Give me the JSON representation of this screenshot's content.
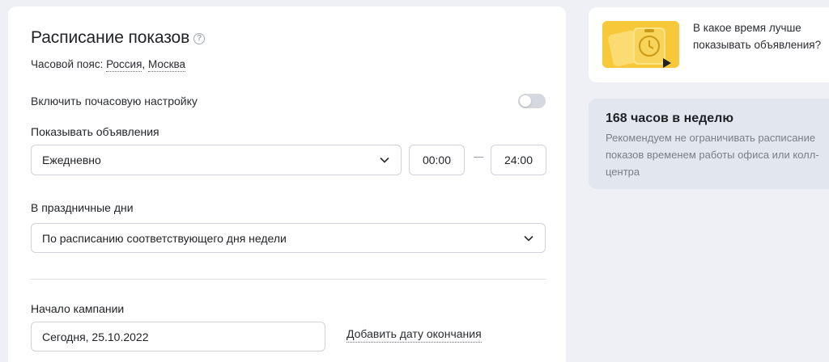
{
  "schedule": {
    "title": "Расписание показов",
    "help_icon": "?",
    "timezone_label": "Часовой пояс:",
    "timezone_country": "Россия",
    "timezone_separator": ",",
    "timezone_city": "Москва",
    "hourly_label": "Включить почасовую настройку",
    "hourly_enabled": false,
    "show_ads_label": "Показывать объявления",
    "show_ads_value": "Ежедневно",
    "time_from": "00:00",
    "time_to": "24:00",
    "holidays_label": "В праздничные дни",
    "holidays_value": "По расписанию соответствующего дня недели",
    "start_label": "Начало кампании",
    "start_value": "Сегодня, 25.10.2022",
    "add_end_date": "Добавить дату окончания"
  },
  "promo": {
    "text": "В какое время лучше показывать объявления?",
    "thumb_icons": [
      "clock-icon",
      "play-icon"
    ],
    "accent": "#f7c93a"
  },
  "info": {
    "title": "168 часов в неделю",
    "text": "Рекомендуем не ограничивать расписание показов временем работы офиса или колл-центра"
  },
  "colors": {
    "page_bg": "#eef0f5",
    "card_bg": "#ffffff",
    "info_bg": "#e2e6ef",
    "border": "#cfd2d8",
    "toggle_off": "#d5d8de"
  }
}
